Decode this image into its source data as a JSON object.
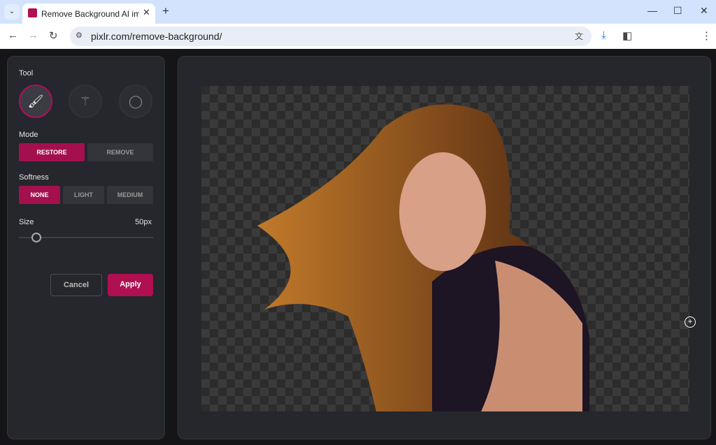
{
  "browser": {
    "tab_title": "Remove Background AI image",
    "url": "pixlr.com/remove-background/",
    "new_tab": "+",
    "close": "✕"
  },
  "panel": {
    "tool_label": "Tool",
    "tools": [
      {
        "icon": "brush-icon",
        "active": true
      },
      {
        "icon": "magic-wand-icon",
        "active": false
      },
      {
        "icon": "lasso-icon",
        "active": false
      }
    ],
    "mode_label": "Mode",
    "modes": [
      "RESTORE",
      "REMOVE"
    ],
    "mode_selected": "RESTORE",
    "softness_label": "Softness",
    "softness": [
      "NONE",
      "LIGHT",
      "MEDIUM"
    ],
    "softness_selected": "NONE",
    "size_label": "Size",
    "size_value": "50px",
    "size_slider_fraction": 0.13,
    "cancel": "Cancel",
    "apply": "Apply"
  },
  "colors": {
    "accent": "#a4104e",
    "panel": "#25272c"
  }
}
